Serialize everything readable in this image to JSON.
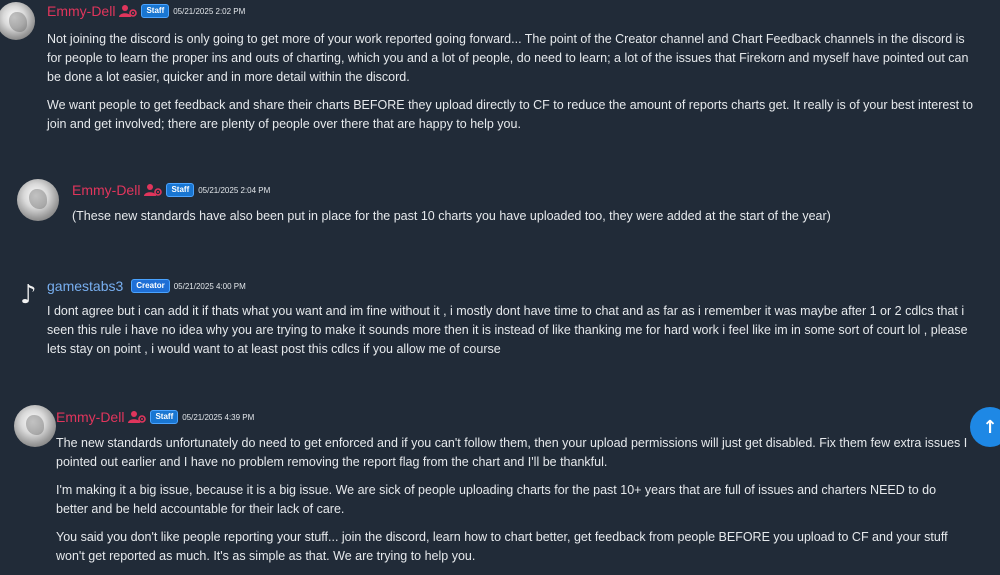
{
  "messages": [
    {
      "username": "Emmy-Dell",
      "badge": "Staff",
      "timestamp": "05/21/2025 2:02 PM",
      "paragraphs": [
        "Not joining the discord is only going to get more of your work reported going forward... The point of the Creator channel and Chart Feedback channels in the discord is for people to learn the proper ins and outs of charting, which you and a lot of people, do need to learn; a lot of the issues that Firekorn and myself have pointed out can be done a lot easier, quicker and in more detail within the discord.",
        "We want people to get feedback and share their charts BEFORE they upload directly to CF to reduce the amount of reports charts get. It really is of your best interest to join and get involved; there are plenty of people over there that are happy to help you."
      ]
    },
    {
      "username": "Emmy-Dell",
      "badge": "Staff",
      "timestamp": "05/21/2025 2:04 PM",
      "paragraphs": [
        "(These new standards have also been put in place for the past 10 charts you have uploaded too, they were added at the start of the year)"
      ]
    },
    {
      "username": "gamestabs3",
      "badge": "Creator",
      "timestamp": "05/21/2025 4:00 PM",
      "paragraphs": [
        "I dont agree but i can add it if thats what you want and im fine without it , i mostly dont have time to chat and as far as i remember it was maybe after 1 or 2 cdlcs that i seen this rule i have no idea why you are trying to make it sounds more then it is instead of like thanking me for hard work i feel like im in some sort of court lol , please lets stay on point , i would want to at least post this cdlcs if you allow me of course"
      ]
    },
    {
      "username": "Emmy-Dell",
      "badge": "Staff",
      "timestamp": "05/21/2025 4:39 PM",
      "paragraphs": [
        "The new standards unfortunately do need to get enforced and if you can't follow them, then your upload permissions will just get disabled. Fix them few extra issues I pointed out earlier and I have no problem removing the report flag from the chart and I'll be thankful.",
        "I'm making it a big issue, because it is a big issue. We are sick of people uploading charts for the past 10+ years that are full of issues and charters NEED to do better and be held accountable for their lack of care.",
        "You said you don't like people reporting your stuff... join the discord, learn how to chart better, get feedback from people BEFORE you upload to CF and your stuff won't get reported as much. It's as simple as that. We are trying to help you."
      ]
    }
  ],
  "scroll_button": {
    "icon": "arrow-up-icon",
    "glyph": "↑"
  },
  "colors": {
    "background": "#212b38",
    "staff_name": "#e0355c",
    "creator_name": "#78aff0",
    "badge_blue": "#1976d2",
    "scroll_button": "#1e88e5"
  }
}
